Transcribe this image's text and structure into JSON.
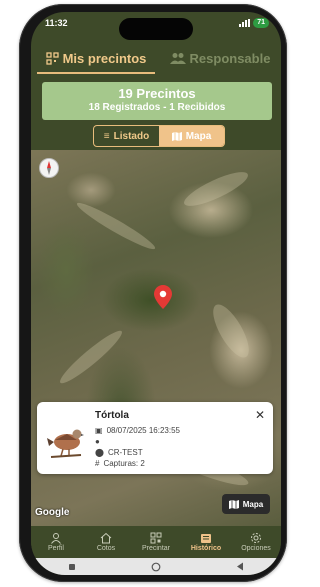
{
  "status": {
    "time": "11:32",
    "battery": "71"
  },
  "tabs": {
    "active": "Mis precintos",
    "inactive": "Responsable"
  },
  "summary": {
    "title": "19 Precintos",
    "subtitle": "18 Registrados - 1 Recibidos"
  },
  "view_toggle": {
    "list_label": "Listado",
    "map_label": "Mapa",
    "selected": "Mapa"
  },
  "map": {
    "attribution": "Google",
    "map_button_label": "Mapa"
  },
  "record": {
    "species": "Tórtola",
    "datetime": "08/07/2025 16:23:55",
    "person": "",
    "location": "CR-TEST",
    "captures": "Capturas: 2"
  },
  "nav": [
    {
      "label": "Perfil",
      "icon": "user-icon"
    },
    {
      "label": "Cotos",
      "icon": "home-icon"
    },
    {
      "label": "Precintar",
      "icon": "qr-icon"
    },
    {
      "label": "Histórico",
      "icon": "history-icon",
      "active": true
    },
    {
      "label": "Opciones",
      "icon": "gear-icon"
    }
  ],
  "colors": {
    "accent": "#f0c38a",
    "header_bg": "#3e4a29",
    "summary_bg": "#a5c88c",
    "pin": "#e53935"
  }
}
